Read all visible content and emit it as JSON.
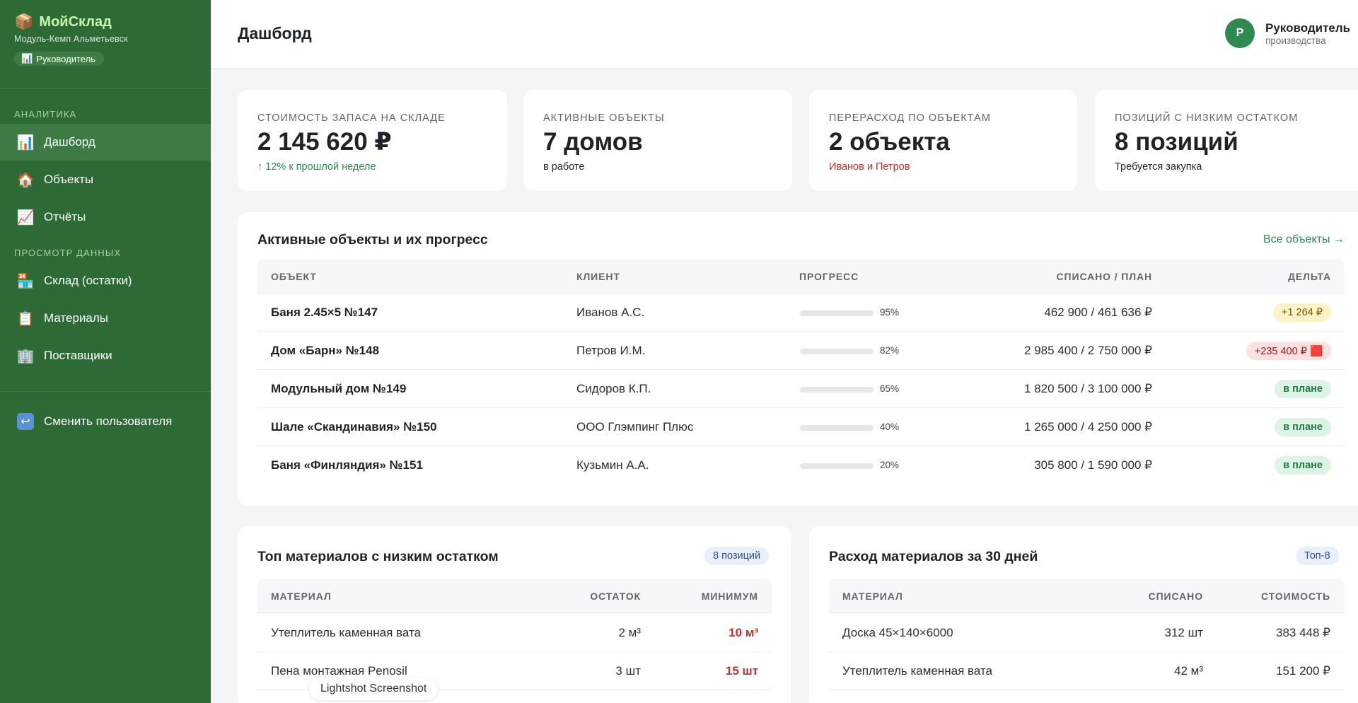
{
  "sidebar": {
    "brand": {
      "icon": "📦",
      "title": "МойСклад",
      "subtitle": "Модуль-Кемп Альметьевск"
    },
    "role_pill": {
      "icon": "📊",
      "label": "Руководитель"
    },
    "sections": [
      {
        "title": "АНАЛИТИКА",
        "items": [
          {
            "icon": "📊",
            "label": "Дашборд",
            "active": true
          },
          {
            "icon": "🏠",
            "label": "Объекты"
          },
          {
            "icon": "📈",
            "label": "Отчёты"
          }
        ]
      },
      {
        "title": "ПРОСМОТР ДАННЫХ",
        "items": [
          {
            "icon": "🏪",
            "label": "Склад (остатки)"
          },
          {
            "icon": "📋",
            "label": "Материалы"
          },
          {
            "icon": "🏢",
            "label": "Поставщики"
          }
        ]
      }
    ],
    "switch_user": {
      "icon": "↩",
      "label": "Сменить пользователя"
    }
  },
  "header": {
    "title": "Дашборд",
    "user": {
      "initial": "Р",
      "name": "Руководитель",
      "role": "производства"
    }
  },
  "kpis": [
    {
      "label": "СТОИМОСТЬ ЗАПАСА НА СКЛАДЕ",
      "value": "2 145 620 ₽",
      "note": "↑ 12% к прошлой неделе",
      "note_color": "#2f8a51"
    },
    {
      "label": "АКТИВНЫЕ ОБЪЕКТЫ",
      "value": "7 домов",
      "note": "в работе",
      "note_color": "#2b2f35"
    },
    {
      "label": "ПЕРЕРАСХОД ПО ОБЪЕКТАМ",
      "value": "2 объекта",
      "note": "Иванов и Петров",
      "note_color": "#c53030"
    },
    {
      "label": "ПОЗИЦИЙ С НИЗКИМ ОСТАТКОМ",
      "value": "8 позиций",
      "note": "Требуется закупка",
      "note_color": "#2b2f35"
    }
  ],
  "projects": {
    "title": "Активные объекты и их прогресс",
    "link": "Все объекты →",
    "columns": {
      "object": "ОБЪЕКТ",
      "client": "КЛИЕНТ",
      "progress": "ПРОГРЕСС",
      "spent": "СПИСАНО / ПЛАН",
      "delta": "ДЕЛЬТА"
    },
    "rows": [
      {
        "object": "Баня 2.45×5 №147",
        "client": "Иванов А.С.",
        "progress": 95,
        "progress_label": "95%",
        "bar_color": "#2f8a51",
        "spent": "462 900 / 461 636 ₽",
        "delta": "+1 264 ₽",
        "delta_type": "warn"
      },
      {
        "object": "Дом «Барн» №148",
        "client": "Петров И.М.",
        "progress": 82,
        "progress_label": "82%",
        "bar_color": "#c53030",
        "spent": "2 985 400 / 2 750 000 ₽",
        "delta": "+235 400 ₽ 🟥",
        "delta_type": "danger"
      },
      {
        "object": "Модульный дом №149",
        "client": "Сидоров К.П.",
        "progress": 65,
        "progress_label": "65%",
        "bar_color": "#3b82f6",
        "spent": "1 820 500 / 3 100 000 ₽",
        "delta": "в плане",
        "delta_type": "ok"
      },
      {
        "object": "Шале «Скандинавия» №150",
        "client": "ООО Глэмпинг Плюс",
        "progress": 40,
        "progress_label": "40%",
        "bar_color": "#3b82f6",
        "spent": "1 265 000 / 4 250 000 ₽",
        "delta": "в плане",
        "delta_type": "ok"
      },
      {
        "object": "Баня «Финляндия» №151",
        "client": "Кузьмин А.А.",
        "progress": 20,
        "progress_label": "20%",
        "bar_color": "#3b82f6",
        "spent": "305 800 / 1 590 000 ₽",
        "delta": "в плане",
        "delta_type": "ok"
      }
    ]
  },
  "low_stock": {
    "title": "Топ материалов с низким остатком",
    "chip": "8 позиций",
    "columns": {
      "material": "МАТЕРИАЛ",
      "stock": "ОСТАТОК",
      "min": "МИНИМУМ"
    },
    "rows": [
      {
        "material": "Утеплитель каменная вата",
        "stock": "2 м³",
        "min": "10 м³"
      },
      {
        "material": "Пена монтажная Penosil",
        "stock": "3 шт",
        "min": "15 шт"
      }
    ]
  },
  "consumption": {
    "title": "Расход материалов за 30 дней",
    "chip": "Топ-8",
    "columns": {
      "material": "МАТЕРИАЛ",
      "spent": "СПИСАНО",
      "cost": "СТОИМОСТЬ"
    },
    "rows": [
      {
        "material": "Доска 45×140×6000",
        "spent": "312 шт",
        "cost": "383 448 ₽"
      },
      {
        "material": "Утеплитель каменная вата",
        "spent": "42 м³",
        "cost": "151 200 ₽"
      }
    ]
  },
  "overlay": {
    "label": "Lightshot Screenshot"
  }
}
